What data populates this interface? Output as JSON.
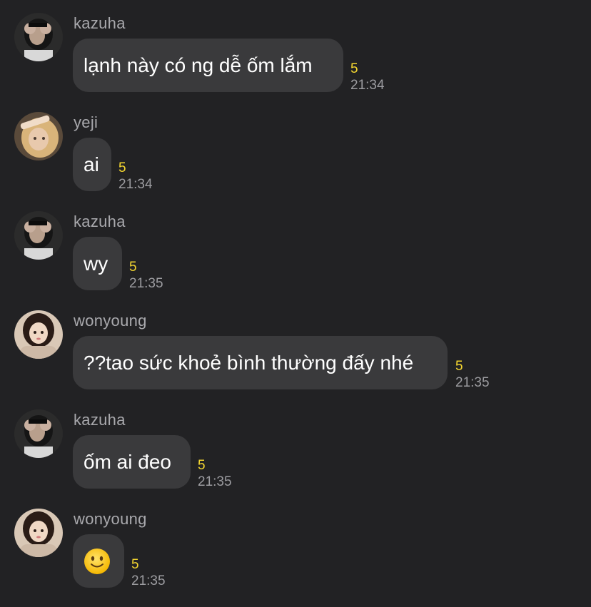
{
  "messages": [
    {
      "sender": "kazuha",
      "avatar_icon": "kazuha-avatar-icon",
      "text": "lạnh này có ng dễ ốm lắm",
      "read_count": "5",
      "time": "21:34"
    },
    {
      "sender": "yeji",
      "avatar_icon": "yeji-avatar-icon",
      "text": "ai",
      "read_count": "5",
      "time": "21:34"
    },
    {
      "sender": "kazuha",
      "avatar_icon": "kazuha-avatar-icon",
      "text": "wy",
      "read_count": "5",
      "time": "21:35"
    },
    {
      "sender": "wonyoung",
      "avatar_icon": "wonyoung-avatar-icon",
      "text": "??tao sức khoẻ bình thường đấy nhé",
      "read_count": "5",
      "time": "21:35"
    },
    {
      "sender": "kazuha",
      "avatar_icon": "kazuha-avatar-icon",
      "text": "ốm ai đeo",
      "read_count": "5",
      "time": "21:35"
    },
    {
      "sender": "wonyoung",
      "avatar_icon": "wonyoung-avatar-icon",
      "emoji": "slightly-smiling-face-emoji",
      "read_count": "5",
      "time": "21:35"
    }
  ],
  "colors": {
    "background": "#222224",
    "bubble": "#3a3a3c",
    "sender_name": "#a9a9ad",
    "read_count": "#f4d630",
    "timestamp": "#9c9ca0"
  }
}
